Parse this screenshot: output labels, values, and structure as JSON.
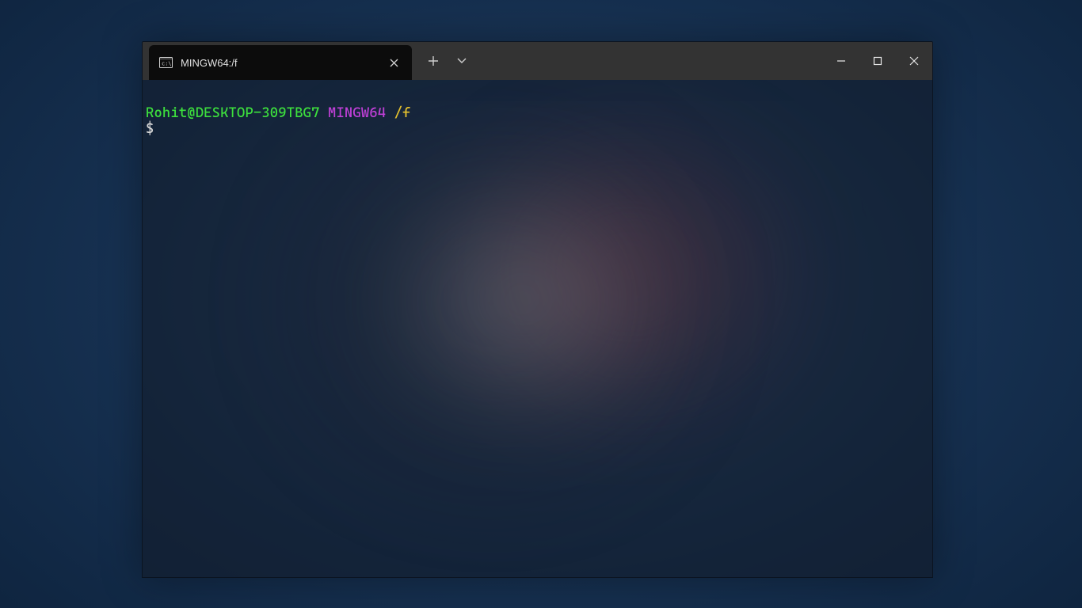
{
  "window": {
    "tab_title": "MINGW64:/f",
    "tab_icon": "terminal-icon"
  },
  "terminal": {
    "prompt": {
      "user_host": "Rohit@DESKTOP-309TBG7",
      "shell_tag": "MINGW64",
      "path": "/f",
      "symbol": "$"
    }
  }
}
